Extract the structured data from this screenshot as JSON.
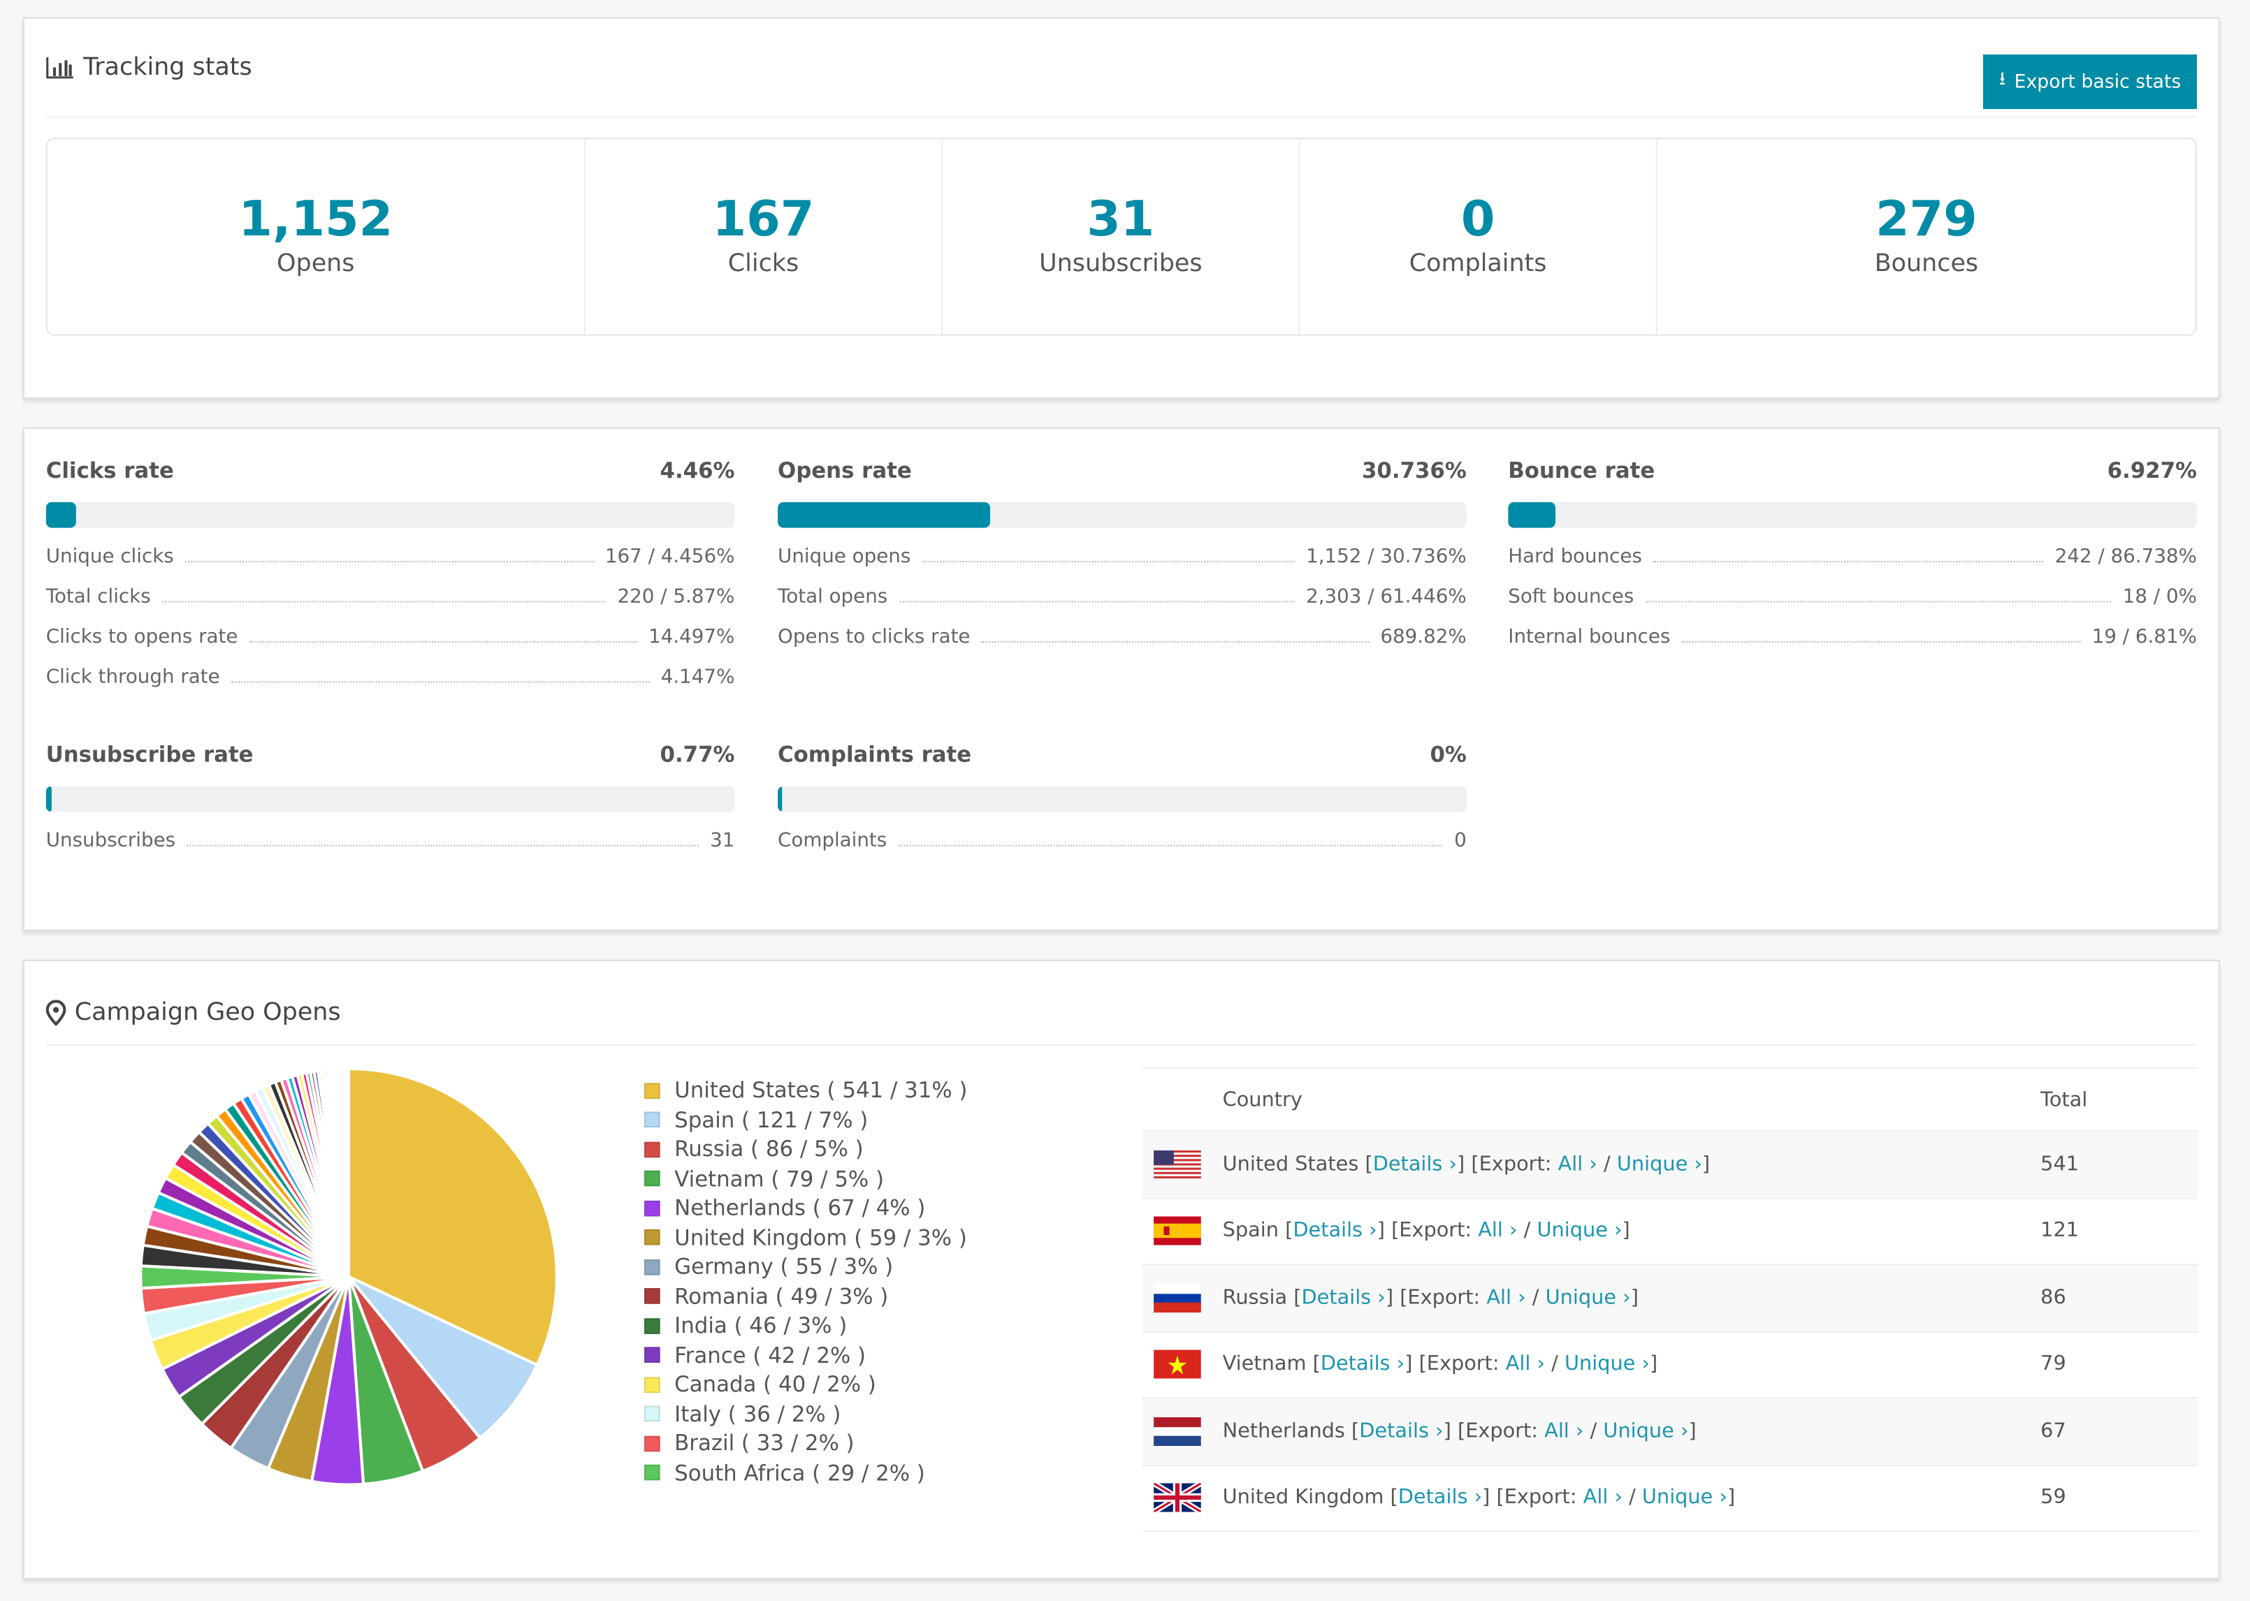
{
  "tracking": {
    "title": "Tracking stats",
    "export_label": "Export basic stats",
    "stats": [
      {
        "value": "1,152",
        "label": "Opens"
      },
      {
        "value": "167",
        "label": "Clicks"
      },
      {
        "value": "31",
        "label": "Unsubscribes"
      },
      {
        "value": "0",
        "label": "Complaints"
      },
      {
        "value": "279",
        "label": "Bounces"
      }
    ]
  },
  "rates": [
    {
      "title": "Clicks rate",
      "value": "4.46%",
      "fill": 4.46,
      "rows": [
        {
          "label": "Unique clicks",
          "value": "167 / 4.456%"
        },
        {
          "label": "Total clicks",
          "value": "220 / 5.87%"
        },
        {
          "label": "Clicks to opens rate",
          "value": "14.497%"
        },
        {
          "label": "Click through rate",
          "value": "4.147%"
        }
      ]
    },
    {
      "title": "Opens rate",
      "value": "30.736%",
      "fill": 30.736,
      "rows": [
        {
          "label": "Unique opens",
          "value": "1,152 / 30.736%"
        },
        {
          "label": "Total opens",
          "value": "2,303 / 61.446%"
        },
        {
          "label": "Opens to clicks rate",
          "value": "689.82%"
        }
      ]
    },
    {
      "title": "Bounce rate",
      "value": "6.927%",
      "fill": 6.927,
      "rows": [
        {
          "label": "Hard bounces",
          "value": "242 / 86.738%"
        },
        {
          "label": "Soft bounces",
          "value": "18 / 0%"
        },
        {
          "label": "Internal bounces",
          "value": "19 / 6.81%"
        }
      ]
    },
    {
      "title": "Unsubscribe rate",
      "value": "0.77%",
      "fill": 0.77,
      "rows": [
        {
          "label": "Unsubscribes",
          "value": "31"
        }
      ]
    },
    {
      "title": "Complaints rate",
      "value": "0%",
      "fill": 0,
      "rows": [
        {
          "label": "Complaints",
          "value": "0"
        }
      ]
    }
  ],
  "geo": {
    "title": "Campaign Geo Opens",
    "table": {
      "headers": [
        "Country",
        "Total"
      ],
      "details": "Details ›",
      "export_prefix": "[Export: ",
      "all": "All ›",
      "unique": "Unique ›",
      "rows": [
        {
          "country": "United States",
          "total": "541",
          "flag": "us"
        },
        {
          "country": "Spain",
          "total": "121",
          "flag": "es"
        },
        {
          "country": "Russia",
          "total": "86",
          "flag": "ru"
        },
        {
          "country": "Vietnam",
          "total": "79",
          "flag": "vn"
        },
        {
          "country": "Netherlands",
          "total": "67",
          "flag": "nl"
        },
        {
          "country": "United Kingdom",
          "total": "59",
          "flag": "gb"
        }
      ]
    }
  },
  "chart_data": {
    "type": "pie",
    "slices": [
      {
        "name": "United States",
        "value": 541,
        "pct": "31%",
        "color": "#ebc03f"
      },
      {
        "name": "Spain",
        "value": 121,
        "pct": "7%",
        "color": "#b4d8f5"
      },
      {
        "name": "Russia",
        "value": 86,
        "pct": "5%",
        "color": "#d24b47"
      },
      {
        "name": "Vietnam",
        "value": 79,
        "pct": "5%",
        "color": "#4caf50"
      },
      {
        "name": "Netherlands",
        "value": 67,
        "pct": "4%",
        "color": "#9b3fe8"
      },
      {
        "name": "United Kingdom",
        "value": 59,
        "pct": "3%",
        "color": "#c09a30"
      },
      {
        "name": "Germany",
        "value": 55,
        "pct": "3%",
        "color": "#8fa8c0"
      },
      {
        "name": "Romania",
        "value": 49,
        "pct": "3%",
        "color": "#a83a3a"
      },
      {
        "name": "India",
        "value": 46,
        "pct": "3%",
        "color": "#3a7a3a"
      },
      {
        "name": "France",
        "value": 42,
        "pct": "2%",
        "color": "#7e3bbf"
      },
      {
        "name": "Canada",
        "value": 40,
        "pct": "2%",
        "color": "#fce95a"
      },
      {
        "name": "Italy",
        "value": 36,
        "pct": "2%",
        "color": "#d6f7f7"
      },
      {
        "name": "Brazil",
        "value": 33,
        "pct": "2%",
        "color": "#f05a5a"
      },
      {
        "name": "South Africa",
        "value": 29,
        "pct": "2%",
        "color": "#5cc85c"
      }
    ],
    "other_values": [
      27,
      25,
      24,
      22,
      21,
      20,
      19,
      18,
      17,
      16,
      15,
      14,
      13,
      12,
      11,
      10,
      10,
      9,
      9,
      8,
      8,
      7,
      7,
      6,
      6,
      5,
      5,
      5,
      4,
      4,
      4,
      3,
      3,
      3,
      3,
      2,
      2,
      2,
      2,
      2,
      1,
      1,
      1,
      1,
      1,
      1
    ]
  }
}
